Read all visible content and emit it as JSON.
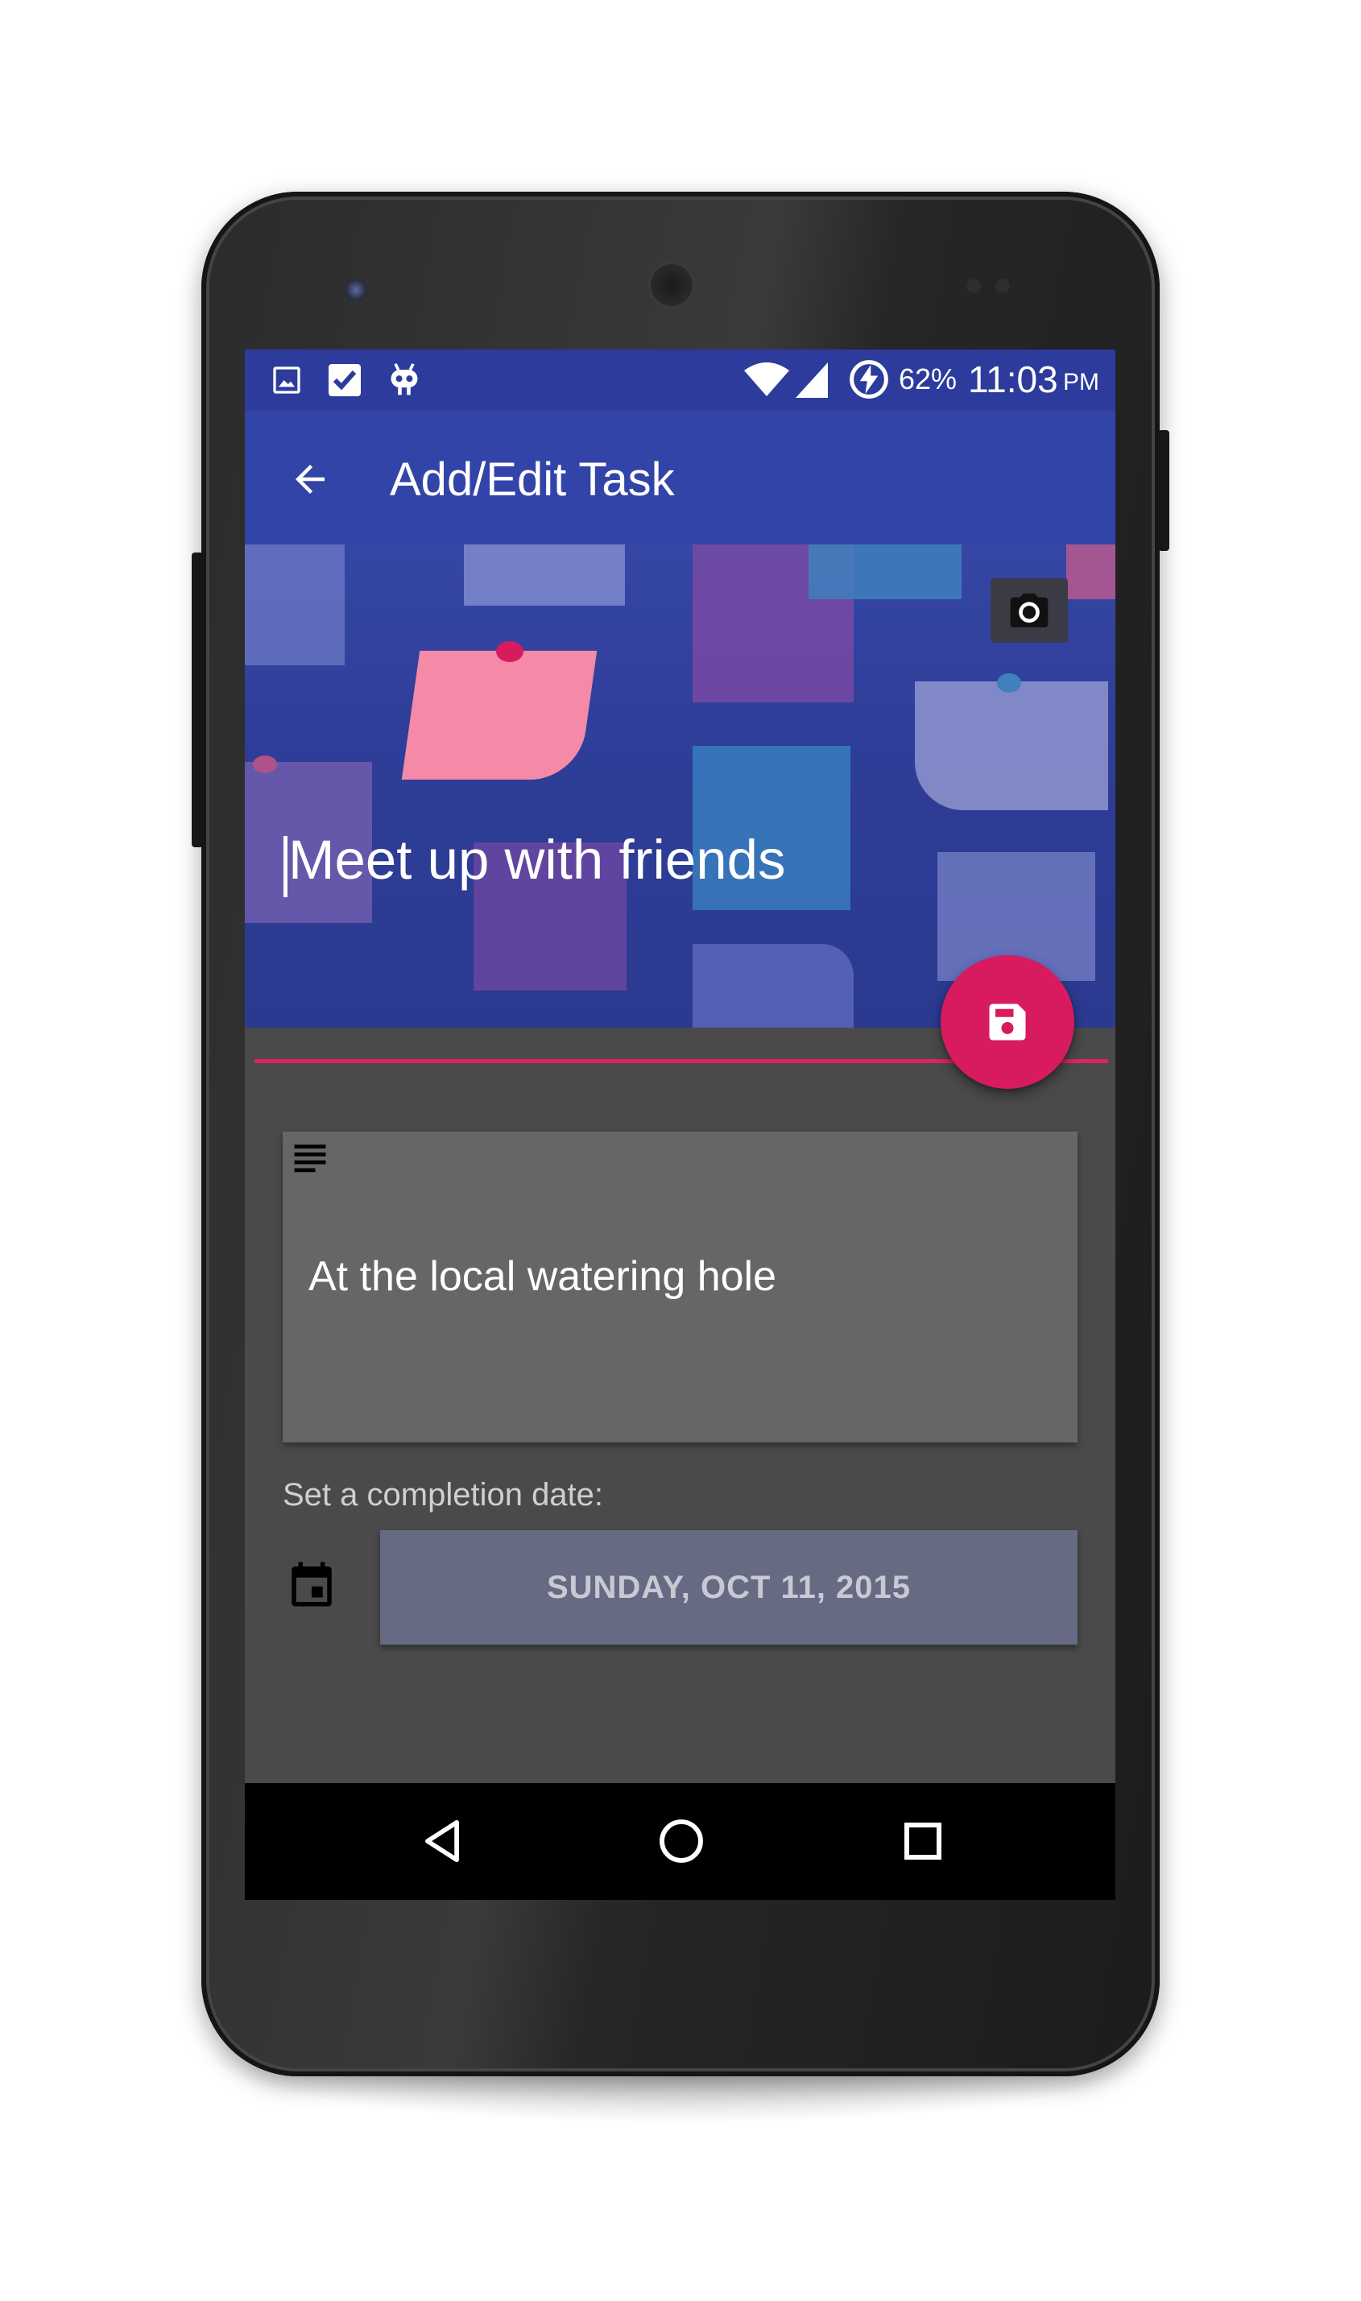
{
  "status_bar": {
    "notification_icons": [
      "image-icon",
      "checkbox-icon",
      "android-robot-icon"
    ],
    "battery_percent": "62%",
    "time": "11:03",
    "ampm": "PM"
  },
  "app_bar": {
    "title": "Add/Edit Task",
    "nav_icon": "arrow-back-icon"
  },
  "task": {
    "title_value": "Meet up with friends",
    "description_value": "At the local watering hole",
    "date_label": "Set a completion date:",
    "date_button": "SUNDAY, OCT 11, 2015"
  },
  "actions": {
    "camera_icon": "camera-icon",
    "save_icon": "save-icon"
  },
  "nav_bar": {
    "buttons": [
      "back-triangle-icon",
      "home-circle-icon",
      "recents-square-icon"
    ]
  },
  "colors": {
    "primary": "#3344a8",
    "primary_dark": "#2c3b9c",
    "accent": "#d81b5f",
    "background": "#4a4a4a",
    "card": "#666666",
    "date_button": "#666a83"
  }
}
